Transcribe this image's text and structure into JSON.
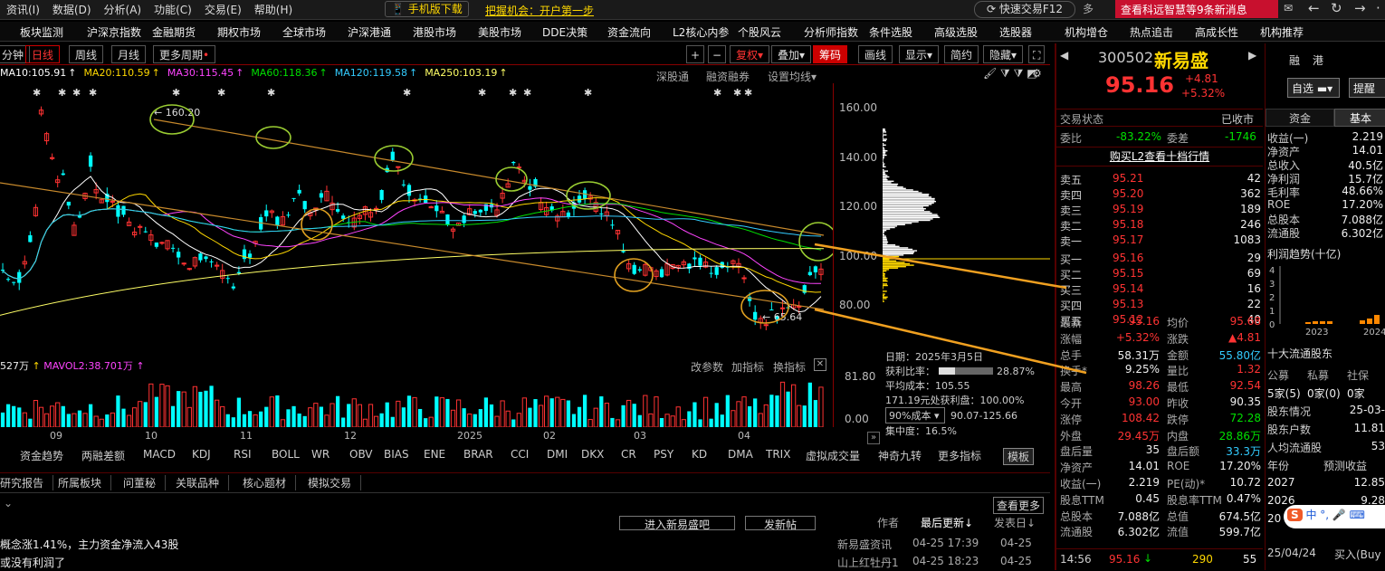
{
  "menu": [
    "资讯(I)",
    "数据(D)",
    "分析(A)",
    "功能(C)",
    "交易(E)",
    "帮助(H)"
  ],
  "mobile_download": "手机版下载",
  "promo": "把握机会：开户第一步",
  "quick_trade": "快速交易F12",
  "news_banner": "查看科远智慧等9条新消息",
  "nav": [
    "板块监测",
    "沪深京指数",
    "金融期货",
    "期权市场",
    "全球市场",
    "沪深港通",
    "港股市场",
    "美股市场",
    "DDE决策",
    "资金流向",
    "L2核心内参",
    "个股风云",
    "分析师指数",
    "条件选股",
    "高级选股",
    "选股器",
    "机构增仓",
    "热点追击",
    "高成长性",
    "机构推荐"
  ],
  "tabs": [
    "分钟",
    "日线",
    "周线",
    "月线",
    "更多周期"
  ],
  "chart_tools": [
    "复权",
    "叠加",
    "筹码",
    "画线",
    "显示",
    "简约",
    "隐藏"
  ],
  "sub_tools": [
    "深股通",
    "融资融券",
    "设置均线"
  ],
  "ma": [
    {
      "t": "MA10:105.91",
      "c": "#ffffff"
    },
    {
      "t": "MA20:110.59",
      "c": "#ffd800"
    },
    {
      "t": "MA30:115.45",
      "c": "#ff44ff"
    },
    {
      "t": "MA60:118.36",
      "c": "#00e000"
    },
    {
      "t": "MA120:119.58",
      "c": "#33ccff"
    },
    {
      "t": "MA250:103.19",
      "c": "#ffff66"
    }
  ],
  "price_axis": [
    "160.00",
    "140.00",
    "120.00",
    "100.00",
    "80.00"
  ],
  "vol_axis": [
    "81.80",
    "0.00"
  ],
  "x_labels": [
    "09",
    "10",
    "11",
    "12",
    "2025",
    "02",
    "03",
    "04"
  ],
  "annot_high": "160.20",
  "annot_low": "65.64",
  "vol_row": {
    "a": "527万",
    "b": "MAVOL2:38.701万"
  },
  "vol_tools": [
    "改参数",
    "加指标",
    "换指标"
  ],
  "chip": {
    "date": "日期：2025年3月5日",
    "profit_label": "获利比率：",
    "profit": "28.87%",
    "avg": "平均成本：105.55",
    "line": "171.19元处获利盘：100.00%",
    "range_label": "90%成本",
    "range": "90.07-125.66",
    "conc": "集中度：16.5%"
  },
  "indicators": [
    "资金趋势",
    "两融差额",
    "MACD",
    "KDJ",
    "RSI",
    "BOLL",
    "WR",
    "OBV",
    "BIAS",
    "ENE",
    "BRAR",
    "CCI",
    "DMI",
    "DKX",
    "CR",
    "PSY",
    "KD",
    "DMA",
    "TRIX",
    "虚拟成交量",
    "神奇九转",
    "更多指标",
    "模板"
  ],
  "bottom_tabs": [
    "研究报告",
    "所属板块",
    "问董秘",
    "关联品种",
    "核心题材",
    "模拟交易"
  ],
  "bottom_buttons": [
    "进入新易盛吧",
    "发新帖"
  ],
  "bottom_header": [
    "作者",
    "最后更新↓",
    "发表日↓"
  ],
  "see_more": "查看更多",
  "posts": [
    {
      "t": "概念涨1.41%，主力资金净流入43股",
      "a": "新易盛资讯",
      "u": "04-25 17:39",
      "d": "04-25"
    },
    {
      "t": "或没有利润了",
      "a": "山上红牡丹1",
      "u": "04-25 18:23",
      "d": "04-25"
    }
  ],
  "stock": {
    "code": "300502",
    "name": "新易盛",
    "price": "95.16",
    "chg": "+4.81",
    "pct": "+5.32%"
  },
  "trade_status": {
    "label": "交易状态",
    "val": "已收市"
  },
  "weibi": {
    "l": "委比",
    "v": "-83.22%",
    "l2": "委差",
    "v2": "-1746"
  },
  "l2": "购买L2查看十档行情",
  "asks": [
    {
      "n": "卖五",
      "p": "95.21",
      "v": "42"
    },
    {
      "n": "卖四",
      "p": "95.20",
      "v": "362"
    },
    {
      "n": "卖三",
      "p": "95.19",
      "v": "189"
    },
    {
      "n": "卖二",
      "p": "95.18",
      "v": "246"
    },
    {
      "n": "卖一",
      "p": "95.17",
      "v": "1083"
    }
  ],
  "bids": [
    {
      "n": "买一",
      "p": "95.16",
      "v": "29"
    },
    {
      "n": "买二",
      "p": "95.15",
      "v": "69"
    },
    {
      "n": "买三",
      "p": "95.14",
      "v": "16"
    },
    {
      "n": "买四",
      "p": "95.13",
      "v": "22"
    },
    {
      "n": "买五",
      "p": "95.12",
      "v": "40"
    }
  ],
  "stats": [
    {
      "l": "最新",
      "v": "95.16",
      "c": "red",
      "l2": "均价",
      "v2": "95.68",
      "c2": "red"
    },
    {
      "l": "涨幅",
      "v": "+5.32%",
      "c": "red",
      "l2": "涨跌",
      "v2": "▲4.81",
      "c2": "red"
    },
    {
      "l": "总手",
      "v": "58.31万",
      "c": "wht",
      "l2": "金额",
      "v2": "55.80亿",
      "c2": "cy"
    },
    {
      "l": "换手*",
      "v": "9.25%",
      "c": "wht",
      "l2": "量比",
      "v2": "1.32",
      "c2": "red"
    },
    {
      "l": "最高",
      "v": "98.26",
      "c": "red",
      "l2": "最低",
      "v2": "92.54",
      "c2": "red"
    },
    {
      "l": "今开",
      "v": "93.00",
      "c": "red",
      "l2": "昨收",
      "v2": "90.35",
      "c2": "wht"
    },
    {
      "l": "涨停",
      "v": "108.42",
      "c": "red",
      "l2": "跌停",
      "v2": "72.28",
      "c2": "green"
    },
    {
      "l": "外盘",
      "v": "29.45万",
      "c": "red",
      "l2": "内盘",
      "v2": "28.86万",
      "c2": "green"
    },
    {
      "l": "盘后量",
      "v": "35",
      "c": "wht",
      "l2": "盘后额",
      "v2": "33.3万",
      "c2": "cy"
    },
    {
      "l": "净资产",
      "v": "14.01",
      "c": "wht",
      "l2": "ROE",
      "v2": "17.20%",
      "c2": "wht"
    },
    {
      "l": "收益(一)",
      "v": "2.219",
      "c": "wht",
      "l2": "PE(动)*",
      "v2": "10.72",
      "c2": "wht"
    },
    {
      "l": "股息TTM",
      "v": "0.45",
      "c": "wht",
      "l2": "股息率TTM",
      "v2": "0.47%",
      "c2": "wht"
    },
    {
      "l": "总股本",
      "v": "7.088亿",
      "c": "wht",
      "l2": "总值",
      "v2": "674.5亿",
      "c2": "wht"
    },
    {
      "l": "流通股",
      "v": "6.302亿",
      "c": "wht",
      "l2": "流值",
      "v2": "599.7亿",
      "c2": "wht"
    }
  ],
  "tick": {
    "time": "14:56",
    "price": "95.16",
    "vol": "290",
    "n": "55"
  },
  "far": {
    "btns": [
      "融",
      "港"
    ],
    "zixuan": "自选",
    "tixing": "提醒",
    "tabs": [
      "资金",
      "基本"
    ],
    "fund": [
      {
        "l": "收益(一)",
        "v": "2.219"
      },
      {
        "l": "净资产",
        "v": "14.01"
      },
      {
        "l": "总收入",
        "v": "40.5亿"
      },
      {
        "l": "净利润",
        "v": "15.7亿"
      },
      {
        "l": "毛利率",
        "v": "48.66%"
      },
      {
        "l": "ROE",
        "v": "17.20%"
      },
      {
        "l": "总股本",
        "v": "7.088亿"
      },
      {
        "l": "流通股",
        "v": "6.302亿"
      }
    ],
    "profit_title": "利润趋势(十亿)",
    "years": [
      "2023",
      "2024"
    ],
    "holders": "十大流通股东",
    "inst": [
      "公募",
      "私募",
      "社保"
    ],
    "inst_v": [
      "5家(5)",
      "0家(0)",
      "0家"
    ],
    "info": [
      {
        "l": "股东情况",
        "v": "25-03-"
      },
      {
        "l": "股东户数",
        "v": "11.81"
      },
      {
        "l": "人均流通股",
        "v": "53"
      }
    ],
    "fc_head": [
      "年份",
      "预测收益"
    ],
    "fc": [
      {
        "y": "2027",
        "v": "12.85"
      },
      {
        "y": "2026",
        "v": "9.28"
      },
      {
        "y": "20",
        "v": ""
      }
    ],
    "last": {
      "d": "25/04/24",
      "a": "买入(Buy"
    }
  }
}
